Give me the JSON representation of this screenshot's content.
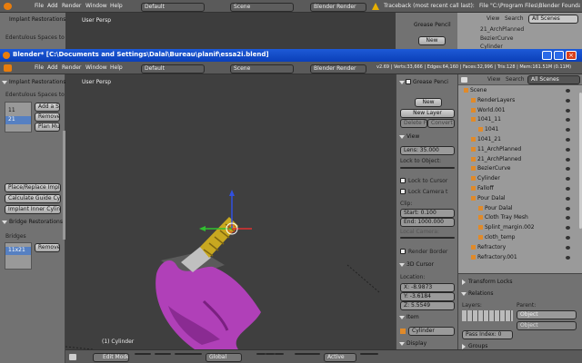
{
  "bg_window": {
    "menu": [
      "File",
      "Add",
      "Render",
      "Window",
      "Help"
    ],
    "layout": "Default",
    "scene": "Scene",
    "engine": "Blender Render",
    "traceback": "Traceback (most recent call last):",
    "file_msg": "File \"C:\\Program Files\\Blender Foundation\\Blender",
    "left_title": "Implant Restorations",
    "left_text": "Edentulous Spaces to Fi",
    "left_btn": "Add a S",
    "viewport_label": "User Persp",
    "grease": "Grease Pencil",
    "new": "New",
    "outliner_items": [
      "21_ArchPlanned",
      "BezierCurve",
      "Cylinder"
    ],
    "view": "View",
    "search": "Search",
    "all_scenes": "All Scenes"
  },
  "window": {
    "title": "Blender* [C:\\Documents and Settings\\Dalal\\Bureau\\planif\\essa2i.blend]"
  },
  "header": {
    "menu": [
      "File",
      "Add",
      "Render",
      "Window",
      "Help"
    ],
    "layout": "Default",
    "scene": "Scene",
    "engine": "Blender Render",
    "stats": "v2.69 | Verts:33,666 | Edges:64,160 | Faces:32,996 | Tris:128 | Mem:161.51M (0.11M)"
  },
  "left_panel": {
    "title": "Implant Restorations",
    "subtitle": "Edentulous Spaces to Fi",
    "list": [
      "11",
      "21"
    ],
    "buttons": [
      "Add a Spa",
      "Remove a",
      "Plan Mult"
    ],
    "actions": [
      "Place/Replace Implant",
      "Calculate Guide Cylind",
      "Implant Inner Cylinders"
    ],
    "bridge_title": "Bridge Restorations",
    "bridges_label": "Bridges",
    "bridge_item": "11x21",
    "bridge_btn": "Remove a"
  },
  "viewport": {
    "label": "User Persp",
    "object_label": "(1) Cylinder"
  },
  "properties": {
    "grease_title": "Grease Penci",
    "new_btn": "New",
    "new_layer": "New Layer",
    "delete_convert": [
      "Delete Fr",
      "Convert"
    ],
    "view_title": "View",
    "lens": "Lens: 35.000",
    "lock_object": "Lock to Object:",
    "lock_cursor": "Lock to Cursor",
    "lock_camera": "Lock Camera t",
    "clip": "Clip:",
    "clip_start": "Start: 0.100",
    "clip_end": "End: 1000.000",
    "local_camera": "Local Camera:",
    "render_border": "Render Border",
    "cursor_title": "3D Cursor",
    "location": "Location:",
    "x": "X: -8.9873",
    "y": "Y: -3.6184",
    "z": "Z: 5.5549",
    "item_title": "Item",
    "item_name": "Cylinder",
    "display_title": "Display"
  },
  "outliner": {
    "header": [
      "View",
      "Search",
      "All Scenes"
    ],
    "items": [
      {
        "name": "Scene",
        "indent": 0
      },
      {
        "name": "RenderLayers",
        "indent": 1
      },
      {
        "name": "World.001",
        "indent": 1
      },
      {
        "name": "1041_11",
        "indent": 1
      },
      {
        "name": "1041",
        "indent": 2
      },
      {
        "name": "1041_21",
        "indent": 1
      },
      {
        "name": "11_ArchPlanned",
        "indent": 1
      },
      {
        "name": "21_ArchPlanned",
        "indent": 1
      },
      {
        "name": "BezierCurve",
        "indent": 1
      },
      {
        "name": "Cylinder",
        "indent": 1
      },
      {
        "name": "Falloff",
        "indent": 1
      },
      {
        "name": "Pour Dalal",
        "indent": 1
      },
      {
        "name": "Pour Dalal",
        "indent": 2
      },
      {
        "name": "Cloth Tray Mesh",
        "indent": 2
      },
      {
        "name": "Splint_margin.002",
        "indent": 2
      },
      {
        "name": "cloth_temp",
        "indent": 2
      },
      {
        "name": "Refractory",
        "indent": 1
      },
      {
        "name": "Refractory.001",
        "indent": 1
      }
    ]
  },
  "object_props": {
    "transform_locks": "Transform Locks",
    "relations": "Relations",
    "layers": "Layers:",
    "parent": "Parent:",
    "parent_value": "Object",
    "pass_index": "Pass Index: 0",
    "groups": "Groups"
  },
  "footer": {
    "mode": "Edit Mode",
    "orientation": "Global",
    "pivot": "Active"
  }
}
